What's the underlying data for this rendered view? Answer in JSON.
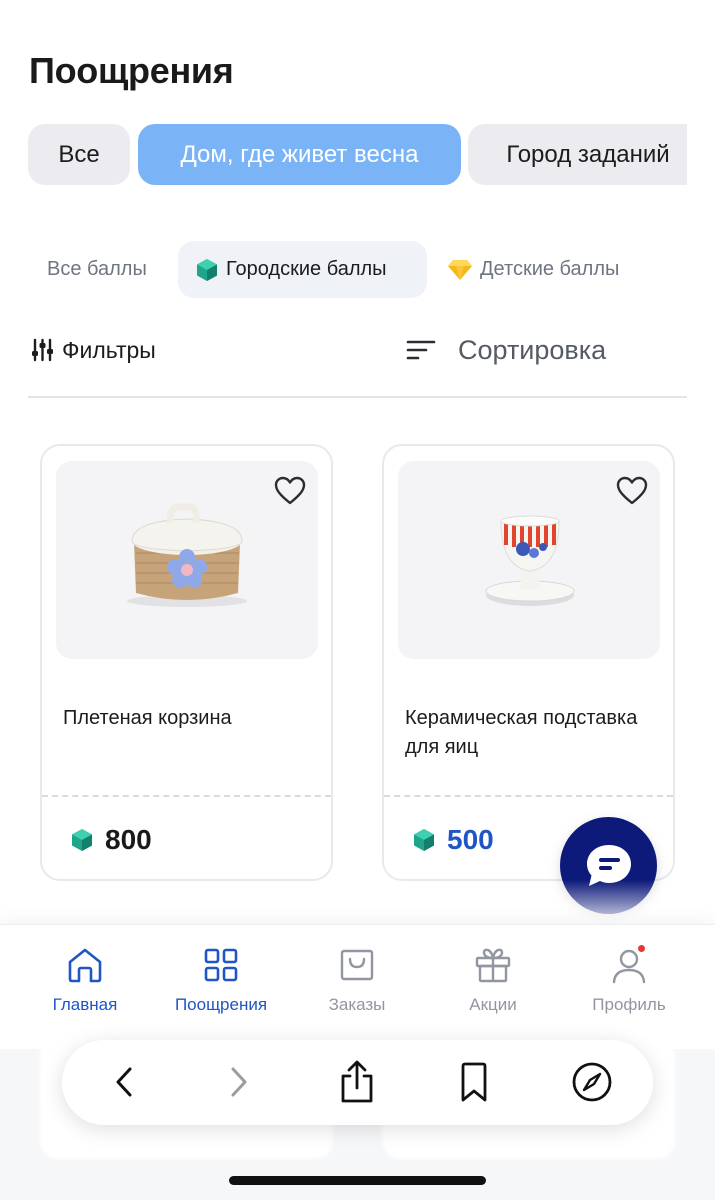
{
  "page": {
    "title": "Поощрения"
  },
  "categories": [
    {
      "label": "Все",
      "active": false
    },
    {
      "label": "Дом, где живет весна",
      "active": true
    },
    {
      "label": "Город заданий",
      "active": false
    }
  ],
  "points_filter": [
    {
      "label": "Все баллы",
      "icon": null,
      "active": false
    },
    {
      "label": "Городские баллы",
      "icon": "green-gem-icon",
      "active": true
    },
    {
      "label": "Детские баллы",
      "icon": "yellow-diamond-icon",
      "active": false
    }
  ],
  "toolbar": {
    "filters_label": "Фильтры",
    "sort_label": "Сортировка"
  },
  "products": [
    {
      "name": "Плетеная корзина",
      "price": "800",
      "currency_icon": "green-gem-icon",
      "favorite": false
    },
    {
      "name": "Керамическая подставка для яиц",
      "price": "500",
      "currency_icon": "green-gem-icon",
      "favorite": false
    }
  ],
  "chat_button": {
    "icon": "chat-bubble-icon"
  },
  "tabbar": [
    {
      "label": "Главная",
      "icon": "home-icon",
      "active": false,
      "color": "#1f55c6"
    },
    {
      "label": "Поощрения",
      "icon": "grid-icon",
      "active": true
    },
    {
      "label": "Заказы",
      "icon": "shopping-bag-icon",
      "active": false
    },
    {
      "label": "Акции",
      "icon": "gift-icon",
      "active": false
    },
    {
      "label": "Профиль",
      "icon": "user-icon",
      "active": false,
      "has_notification": true
    }
  ],
  "colors": {
    "accent": "#1f55c6",
    "chip_active": "#7ab3f6",
    "fab": "#0d1a7a",
    "gem": "#1fa58a",
    "notification": "#e53935"
  }
}
